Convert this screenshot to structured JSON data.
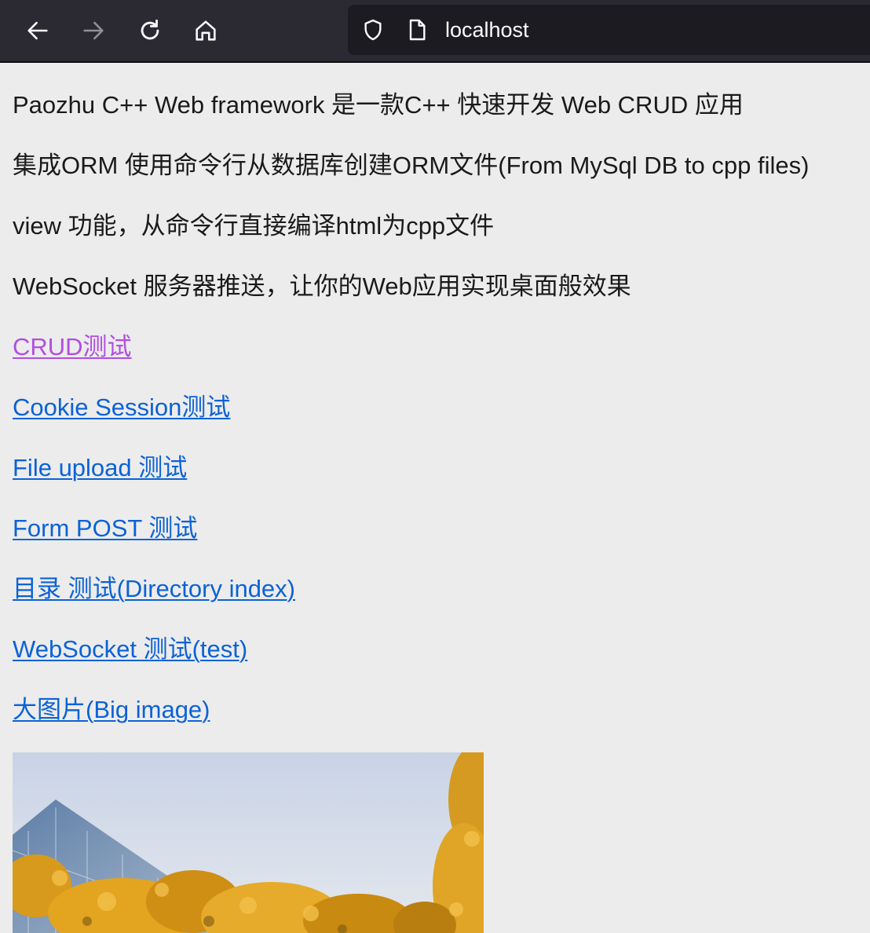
{
  "browser": {
    "url": "localhost",
    "icons": {
      "back": "back-arrow-icon",
      "forward": "forward-arrow-icon",
      "reload": "reload-icon",
      "home": "home-icon",
      "shield": "shield-icon",
      "page": "page-icon"
    }
  },
  "content": {
    "paragraphs": [
      "Paozhu C++ Web framework 是一款C++ 快速开发 Web CRUD 应用",
      "集成ORM 使用命令行从数据库创建ORM文件(From MySql DB to cpp files)",
      "view 功能，从命令行直接编译html为cpp文件",
      "WebSocket 服务器推送，让你的Web应用实现桌面般效果"
    ],
    "links": [
      "CRUD测试",
      "Cookie Session测试",
      "File upload 测试",
      "Form POST 测试",
      "目录 测试(Directory index)",
      "WebSocket 测试(test)",
      "大图片(Big image)"
    ]
  },
  "colors": {
    "toolbar_bg": "#2b2a33",
    "urlbar_bg": "#1c1b22",
    "page_bg": "#ececec",
    "link": "#0b62d6",
    "link_visited": "#b24ee0"
  }
}
